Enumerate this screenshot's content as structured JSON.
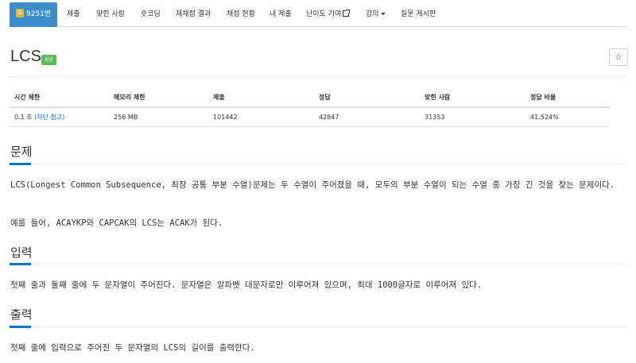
{
  "nav": {
    "tabs": [
      {
        "label": "9251번",
        "active": true,
        "icon": "tier-badge-icon"
      },
      {
        "label": "제출"
      },
      {
        "label": "맞힌 사람"
      },
      {
        "label": "숏코딩"
      },
      {
        "label": "재채점 결과"
      },
      {
        "label": "채점 현황"
      },
      {
        "label": "내 제출"
      },
      {
        "label": "난이도 기여",
        "icon": "external-link-icon"
      },
      {
        "label": "강의",
        "icon": "caret-down-icon"
      },
      {
        "label": "질문 게시판"
      }
    ],
    "tier_text": "G"
  },
  "problem": {
    "title": "LCS",
    "status_badge": "성공",
    "star_icon": "☆"
  },
  "info_table": {
    "headers": [
      "시간 제한",
      "메모리 제한",
      "제출",
      "정답",
      "맞힌 사람",
      "정답 비율"
    ],
    "time_limit": "0.1 초 ",
    "time_limit_link": "(하단 참고)",
    "memory_limit": "256 MB",
    "submissions": "101442",
    "accepted": "42847",
    "solved_users": "31353",
    "accept_ratio": "41.524%"
  },
  "sections": {
    "problem_heading": "문제",
    "problem_p1": "LCS(Longest Common Subsequence, 최장 공통 부분 수열)문제는 두 수열이 주어졌을 때, 모두의 부분 수열이 되는 수열 중 가장 긴 것을 찾는 문제이다.",
    "problem_p2": "예를 들어, ACAYKP와 CAPCAK의 LCS는 ACAK가 된다.",
    "input_heading": "입력",
    "input_p": "첫째 줄과 둘째 줄에 두 문자열이 주어진다. 문자열은 알파벳 대문자로만 이루어져 있으며, 최대 1000글자로 이루어져 있다.",
    "output_heading": "출력",
    "output_p": "첫째 줄에 입력으로 주어진 두 문자열의 LCS의 길이를 출력한다."
  },
  "colors": {
    "accent": "#0076c0",
    "active_tab": "#3c8dca",
    "success": "#5cb85c",
    "tier": "#e5b13a"
  }
}
